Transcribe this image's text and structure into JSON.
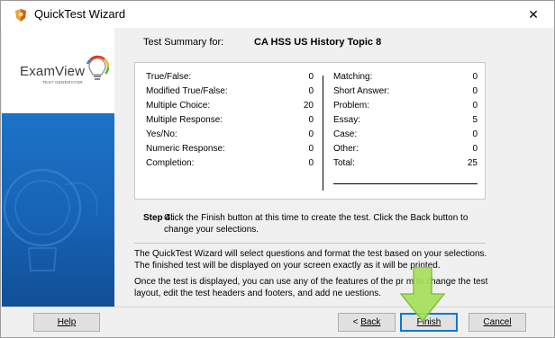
{
  "window": {
    "title": "QuickTest Wizard",
    "close_glyph": "✕"
  },
  "logo": {
    "text": "ExamView",
    "sub": "TEST GENERATOR"
  },
  "summary": {
    "label": "Test Summary for:",
    "value": "CA HSS US History Topic 8",
    "left": [
      {
        "label": "True/False:",
        "count": "0"
      },
      {
        "label": "Modified True/False:",
        "count": "0"
      },
      {
        "label": "Multiple Choice:",
        "count": "20"
      },
      {
        "label": "Multiple Response:",
        "count": "0"
      },
      {
        "label": "Yes/No:",
        "count": "0"
      },
      {
        "label": "Numeric Response:",
        "count": "0"
      },
      {
        "label": "Completion:",
        "count": "0"
      }
    ],
    "right": [
      {
        "label": "Matching:",
        "count": "0"
      },
      {
        "label": "Short Answer:",
        "count": "0"
      },
      {
        "label": "Problem:",
        "count": "0"
      },
      {
        "label": "Essay:",
        "count": "5"
      },
      {
        "label": "Case:",
        "count": "0"
      },
      {
        "label": "Other:",
        "count": "0"
      },
      {
        "label": "Total:",
        "count": "25"
      }
    ]
  },
  "step": {
    "label": "Step 4:",
    "text": "Click the Finish button at this time to create the test. Click the Back button to change your selections."
  },
  "info": {
    "p1": "The QuickTest Wizard will select questions and format the test based on your selections. The finished test will be displayed on your screen exactly as it will be printed.",
    "p2": "Once the test is displayed, you can use any of the features of the pr        m to change the test layout, edit the test headers and footers, and add ne     uestions."
  },
  "buttons": {
    "help": "Help",
    "back_prefix": "< ",
    "back": "Back",
    "finish": "Finish",
    "cancel": "Cancel"
  },
  "colors": {
    "sidebar_blue": "#1663b5",
    "arrow_green": "#a6e05a",
    "default_button_border": "#0078d7"
  },
  "icons": {
    "app": "quicktest-wizard-icon",
    "logo_bulb": "lightbulb-icon",
    "arrow": "down-arrow-icon"
  }
}
